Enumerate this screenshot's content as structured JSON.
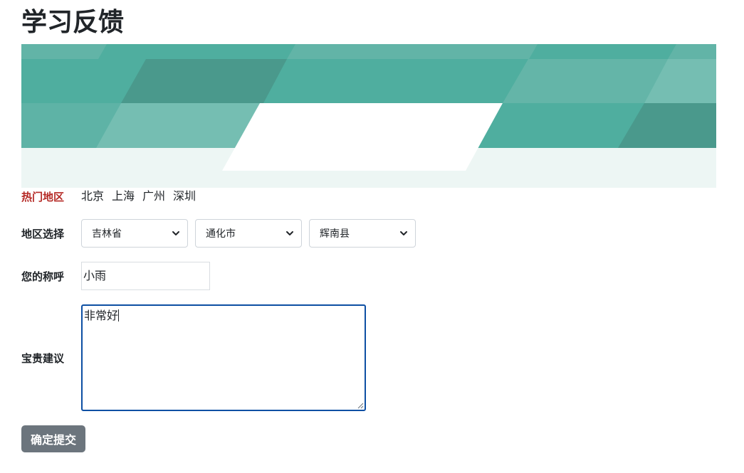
{
  "page": {
    "title": "学习反馈"
  },
  "hot_regions": {
    "label": "热门地区",
    "cities": [
      "北京",
      "上海",
      "广州",
      "深圳"
    ]
  },
  "region_select": {
    "label": "地区选择",
    "province": "吉林省",
    "city": "通化市",
    "county": "辉南县"
  },
  "name_field": {
    "label": "您的称呼",
    "value": "小雨"
  },
  "suggestion_field": {
    "label": "宝贵建议",
    "value": "非常好"
  },
  "submit": {
    "label": "确定提交"
  },
  "colors": {
    "accent_teal": "#4fae9f",
    "hot_label": "#b52a26",
    "button_bg": "#6c757d",
    "focus_border": "#0d4fa3"
  }
}
